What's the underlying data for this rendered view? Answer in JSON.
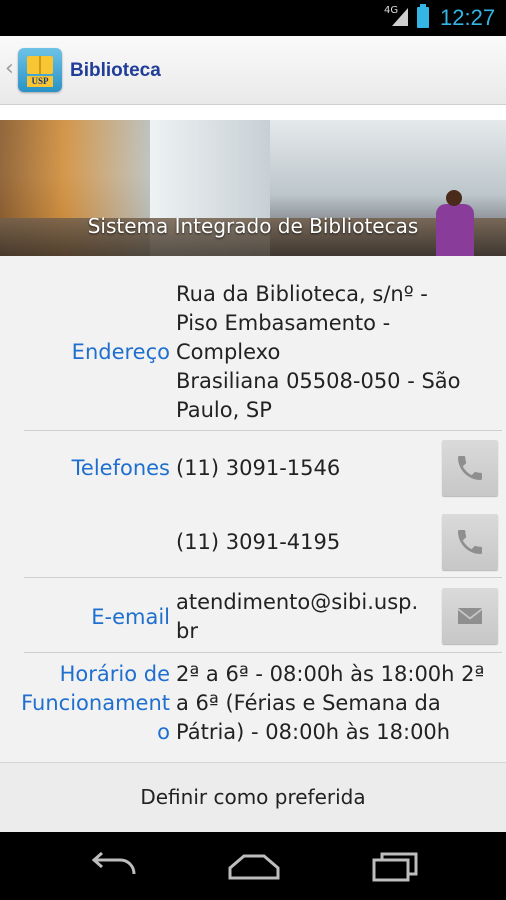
{
  "status": {
    "network": "4G",
    "time": "12:27"
  },
  "action_bar": {
    "title": "Biblioteca",
    "logo_text": "USP"
  },
  "banner": {
    "caption": "Sistema Integrado de Bibliotecas"
  },
  "details": {
    "address": {
      "label": "Endereço",
      "lines": [
        "Rua da Biblioteca, s/nº -",
        "Piso Embasamento -",
        "Complexo",
        "Brasiliana 05508-050 - São",
        "Paulo, SP"
      ]
    },
    "phones": {
      "label": "Telefones",
      "items": [
        "(11) 3091-1546",
        "(11) 3091-4195"
      ]
    },
    "email": {
      "label": "E-email",
      "lines": [
        "atendimento@sibi.usp.",
        "br"
      ]
    },
    "hours": {
      "label_lines": [
        "Horário de",
        "Funcionament",
        "o"
      ],
      "lines": [
        "2ª a 6ª - 08:00h às 18:00h 2ª",
        "a 6ª (Férias e Semana da",
        "Pátria) - 08:00h às 18:00h"
      ]
    }
  },
  "favorite_button": {
    "label": "Definir como preferida"
  }
}
